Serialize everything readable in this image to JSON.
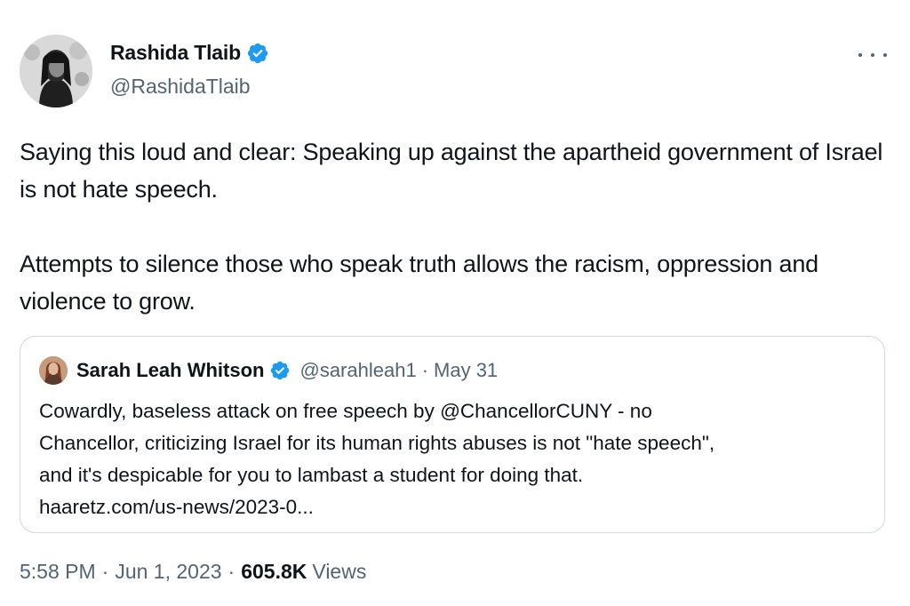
{
  "author": {
    "name": "Rashida Tlaib",
    "handle": "@RashidaTlaib",
    "verified_color": "#1d9bf0"
  },
  "icons": {
    "verified": "verified-badge-icon",
    "more": "more-options-icon"
  },
  "tweet": {
    "paragraph1": "Saying this loud and clear: Speaking up against the apartheid government of Israel is not hate speech.",
    "paragraph2": "Attempts to silence those who speak truth allows the racism, oppression and violence to grow."
  },
  "quote": {
    "name": "Sarah Leah Whitson",
    "handle": "@sarahleah1",
    "separator": "·",
    "date": "May 31",
    "lines": [
      "Cowardly, baseless attack on free speech by @ChancellorCUNY  - no",
      "Chancellor, criticizing Israel for its human rights abuses is not \"hate speech\",",
      "and it's despicable for you to lambast a student for doing that.",
      "haaretz.com/us-news/2023-0..."
    ]
  },
  "meta": {
    "time": "5:58 PM",
    "date": "Jun 1, 2023",
    "separator": "·",
    "views_count": "605.8K",
    "views_label": "Views"
  },
  "colors": {
    "text_primary": "#0f1419",
    "text_secondary": "#536471",
    "border": "#cfd9de",
    "accent": "#1d9bf0"
  }
}
